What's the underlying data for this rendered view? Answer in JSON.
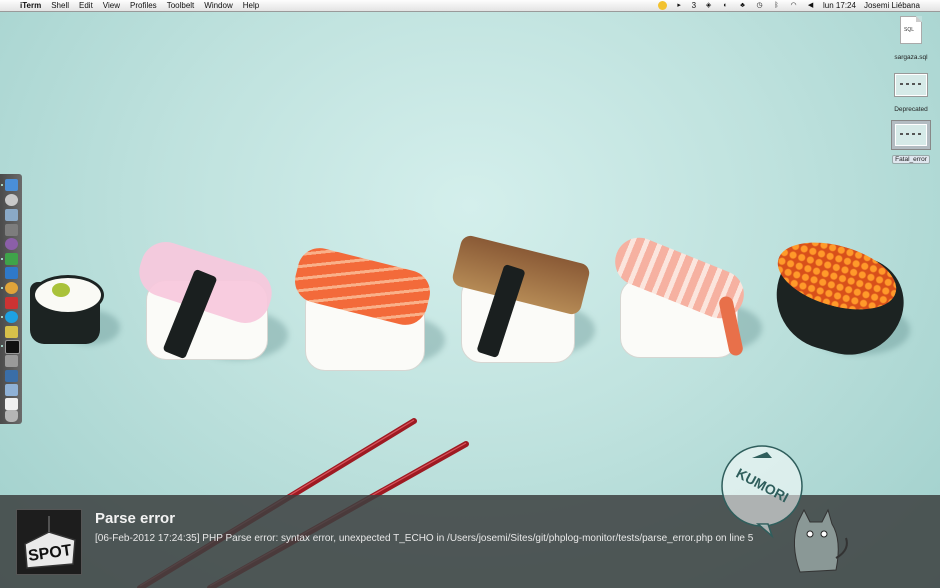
{
  "menubar": {
    "apple_glyph": "",
    "app_name": "iTerm",
    "menus": [
      "Shell",
      "Edit",
      "View",
      "Profiles",
      "Toolbelt",
      "Window",
      "Help"
    ],
    "status": {
      "badge_count": "3",
      "clock": "lun 17:24",
      "user": "Josemi Liébana"
    }
  },
  "desktop": {
    "icons": [
      {
        "label": "sargaza.sql",
        "kind": "sql-file-icon",
        "file_tag": "SQL"
      },
      {
        "label": "Deprecated",
        "kind": "screenshot-icon"
      },
      {
        "label": "Fatal_error",
        "kind": "screenshot-icon",
        "selected": true
      }
    ]
  },
  "dock": {
    "apps": [
      "finder-icon",
      "safari-icon",
      "mail-icon",
      "photo-icon",
      "tor-icon",
      "adium-icon",
      "cursor-icon",
      "chrome-icon",
      "skype-icon",
      "adobe-icon",
      "terminal-icon",
      "monitor-icon",
      "dashboard-icon",
      "folder-icon",
      "document-icon",
      "trash-icon"
    ]
  },
  "mascot": {
    "text": "KUMORI"
  },
  "notification": {
    "icon_text": "SPOT",
    "title": "Parse error",
    "message": "[06-Feb-2012 17:24:35] PHP Parse error:  syntax error, unexpected T_ECHO in /Users/josemi/Sites/git/phplog-monitor/tests/parse_error.php on line 5"
  },
  "colors": {
    "wallpaper": "#bfe0dd",
    "notification_bg": "#3c4040",
    "chopstick": "#a01820"
  }
}
